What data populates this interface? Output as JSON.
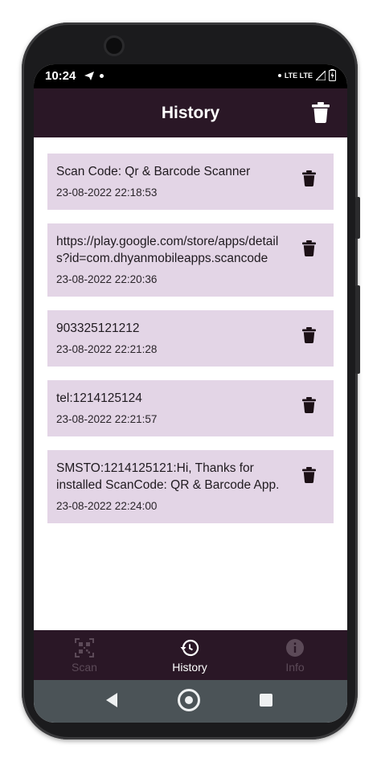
{
  "status_bar": {
    "time": "10:24",
    "network": "LTE LTE"
  },
  "app_bar": {
    "title": "History"
  },
  "history_items": [
    {
      "text": "Scan Code: Qr & Barcode Scanner",
      "date": "23-08-2022 22:18:53"
    },
    {
      "text": "https://play.google.com/store/apps/details?id=com.dhyanmobileapps.scancode",
      "date": "23-08-2022 22:20:36"
    },
    {
      "text": "903325121212",
      "date": "23-08-2022 22:21:28"
    },
    {
      "text": "tel:1214125124",
      "date": "23-08-2022 22:21:57"
    },
    {
      "text": "SMSTO:1214125121:Hi, Thanks for installed ScanCode: QR & Barcode App.",
      "date": "23-08-2022 22:24:00"
    }
  ],
  "bottom_nav": {
    "items": [
      {
        "label": "Scan",
        "icon": "qr-scan-icon",
        "active": false
      },
      {
        "label": "History",
        "icon": "history-icon",
        "active": true
      },
      {
        "label": "Info",
        "icon": "info-icon",
        "active": false
      }
    ]
  },
  "colors": {
    "app_bar": "#2a1726",
    "card_background": "#e3d5e6",
    "system_nav": "#4b5357"
  }
}
